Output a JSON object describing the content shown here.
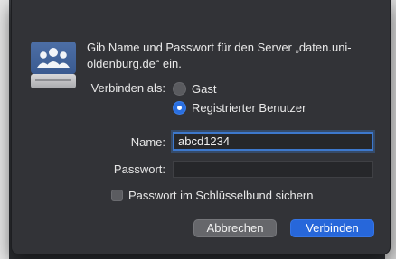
{
  "dialog": {
    "message": "Gib Name und Passwort für den Server „daten.uni-oldenburg.de“ ein.",
    "connect_as_label": "Verbinden als:",
    "radio_guest": "Gast",
    "radio_registered": "Registrierter Benutzer",
    "selected_option": "Registrierter Benutzer",
    "name_label": "Name:",
    "name_value": "abcd1234",
    "password_label": "Passwort:",
    "password_value": "",
    "keychain_label": "Passwort im Schlüsselbund sichern",
    "keychain_checked": false,
    "cancel_label": "Abbrechen",
    "connect_label": "Verbinden"
  },
  "icons": {
    "server": "server-users-icon"
  },
  "colors": {
    "accent": "#2767da",
    "dialog_bg": "#323337"
  }
}
